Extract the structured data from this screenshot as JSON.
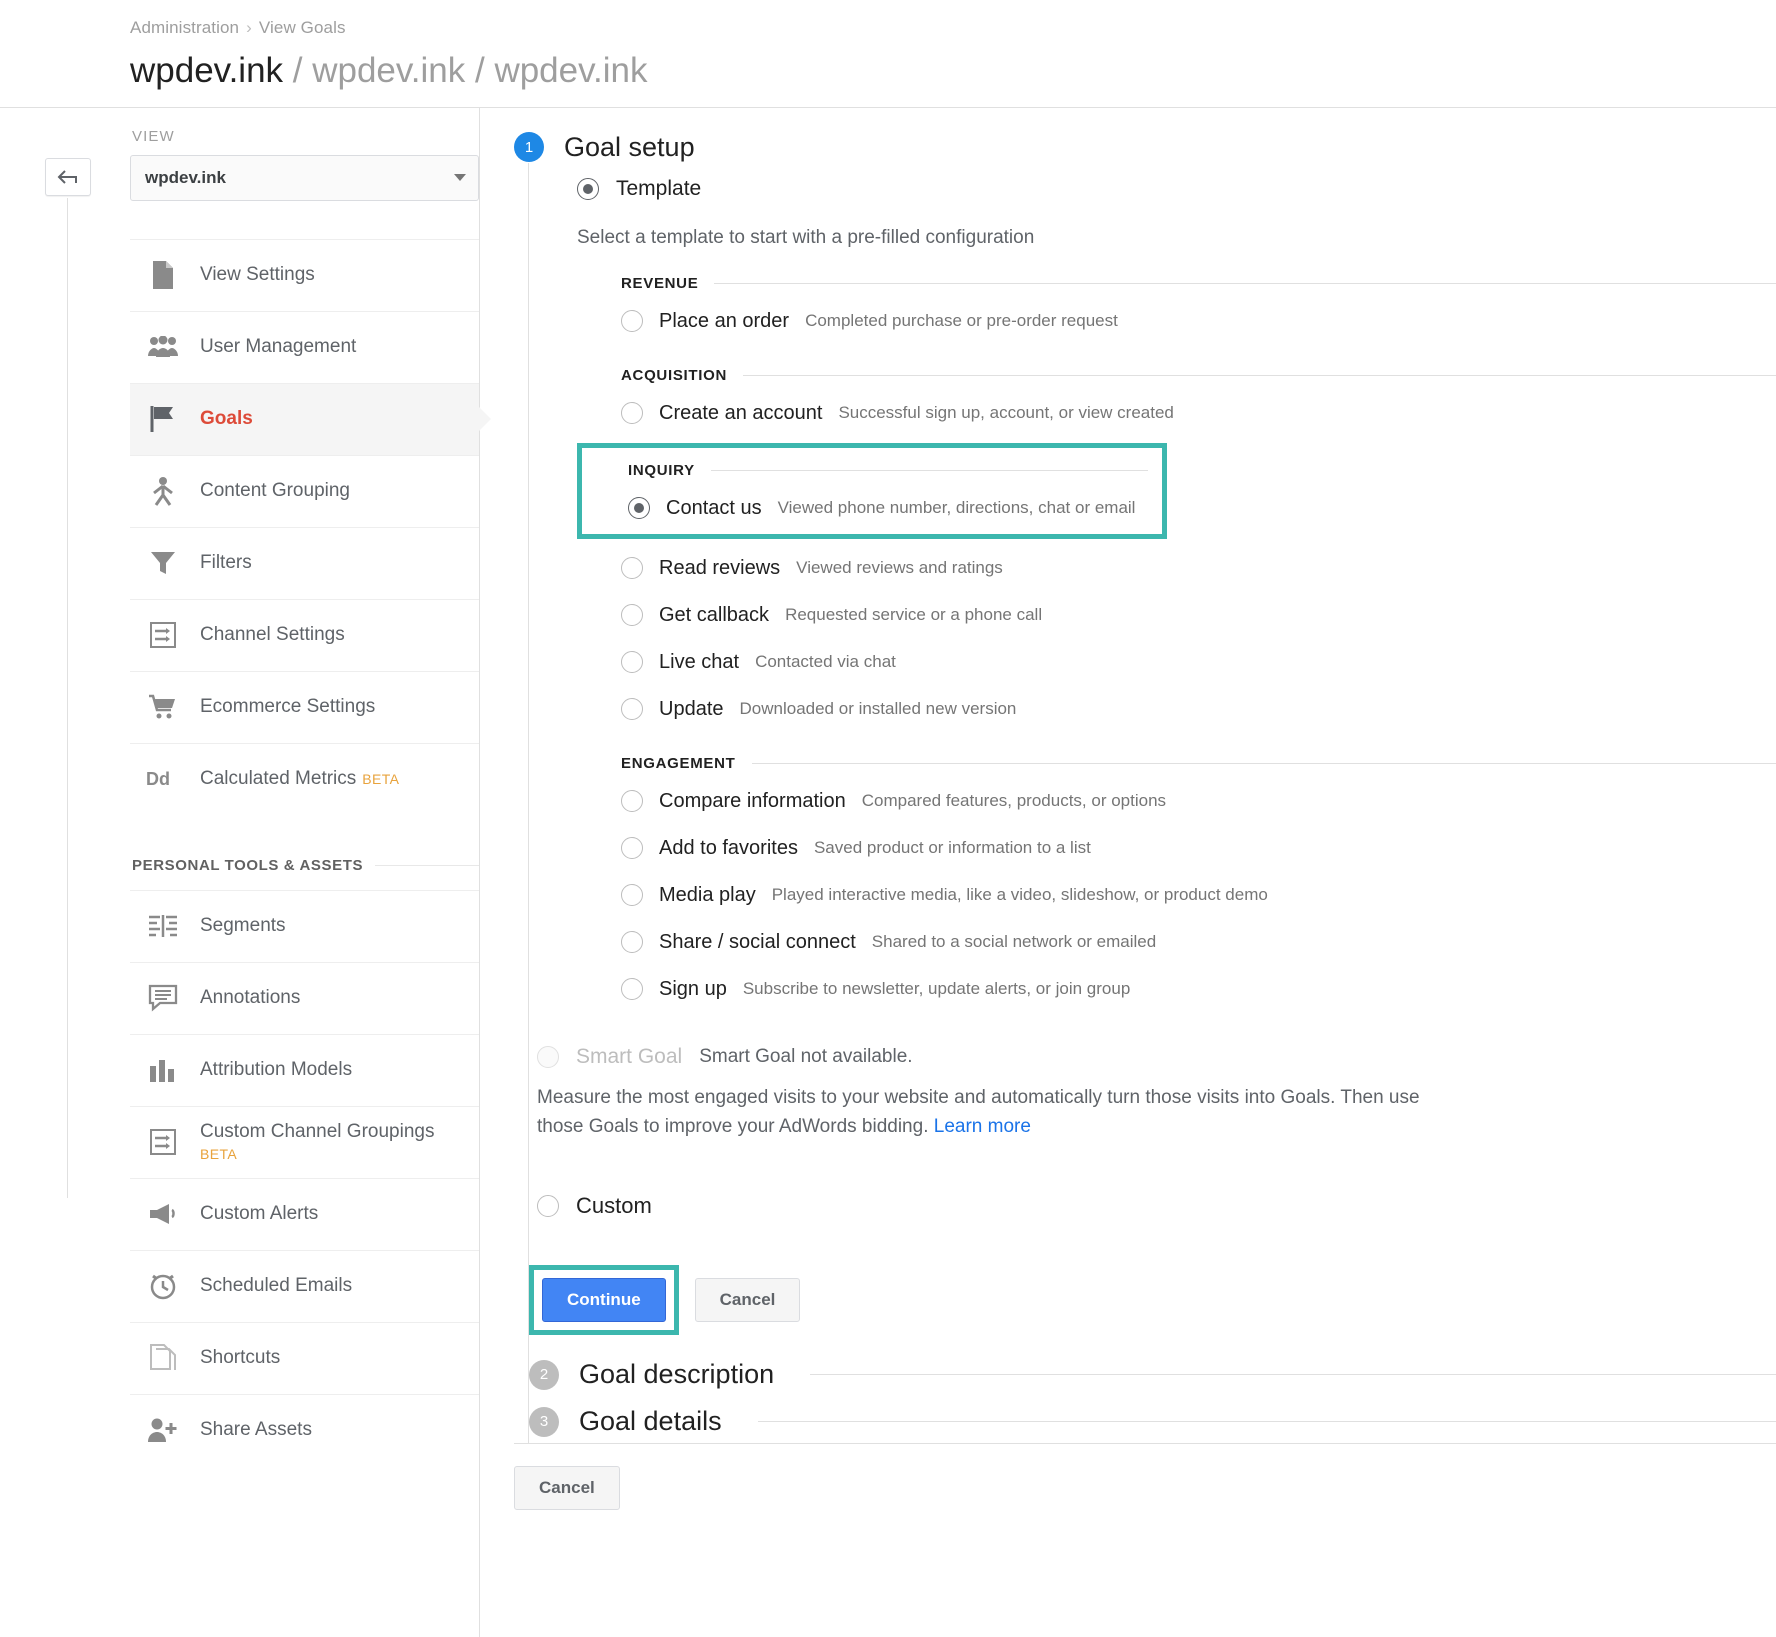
{
  "header": {
    "breadcrumb": [
      "Administration",
      "View Goals"
    ],
    "breadcrumb_separator": "›",
    "title_main": "wpdev.ink",
    "title_rest": "/ wpdev.ink / wpdev.ink"
  },
  "sidebar": {
    "view_label": "VIEW",
    "view_value": "wpdev.ink",
    "items": [
      {
        "label": "View Settings",
        "icon": "document-icon",
        "active": false
      },
      {
        "label": "User Management",
        "icon": "people-icon",
        "active": false
      },
      {
        "label": "Goals",
        "icon": "flag-icon",
        "active": true
      },
      {
        "label": "Content Grouping",
        "icon": "content-grouping-icon",
        "active": false
      },
      {
        "label": "Filters",
        "icon": "funnel-icon",
        "active": false
      },
      {
        "label": "Channel Settings",
        "icon": "channel-settings-icon",
        "active": false
      },
      {
        "label": "Ecommerce Settings",
        "icon": "cart-icon",
        "active": false
      },
      {
        "label": "Calculated Metrics",
        "icon": "dd-icon",
        "badge": "BETA",
        "active": false
      }
    ],
    "personal_section_label": "PERSONAL TOOLS & ASSETS",
    "personal_items": [
      {
        "label": "Segments",
        "icon": "segments-icon"
      },
      {
        "label": "Annotations",
        "icon": "annotation-icon"
      },
      {
        "label": "Attribution Models",
        "icon": "bar-chart-icon"
      },
      {
        "label": "Custom Channel Groupings",
        "icon": "channel-settings-icon",
        "badge": "BETA"
      },
      {
        "label": "Custom Alerts",
        "icon": "megaphone-icon"
      },
      {
        "label": "Scheduled Emails",
        "icon": "alarm-clock-icon"
      },
      {
        "label": "Shortcuts",
        "icon": "pages-icon"
      },
      {
        "label": "Share Assets",
        "icon": "person-add-icon"
      }
    ]
  },
  "main": {
    "step1": {
      "number": "1",
      "title": "Goal setup",
      "template_option_label": "Template",
      "template_selected": true,
      "template_description": "Select a template to start with a pre-filled configuration",
      "groups": [
        {
          "name": "REVENUE",
          "highlighted": false,
          "options": [
            {
              "name": "Place an order",
              "desc": "Completed purchase or pre-order request",
              "selected": false
            }
          ]
        },
        {
          "name": "ACQUISITION",
          "highlighted": false,
          "options": [
            {
              "name": "Create an account",
              "desc": "Successful sign up, account, or view created",
              "selected": false
            }
          ]
        },
        {
          "name": "INQUIRY",
          "highlighted": true,
          "options": [
            {
              "name": "Contact us",
              "desc": "Viewed phone number, directions, chat or email",
              "selected": true
            }
          ]
        },
        {
          "name": "",
          "highlighted": false,
          "options": [
            {
              "name": "Read reviews",
              "desc": "Viewed reviews and ratings",
              "selected": false
            },
            {
              "name": "Get callback",
              "desc": "Requested service or a phone call",
              "selected": false
            },
            {
              "name": "Live chat",
              "desc": "Contacted via chat",
              "selected": false
            },
            {
              "name": "Update",
              "desc": "Downloaded or installed new version",
              "selected": false
            }
          ]
        },
        {
          "name": "ENGAGEMENT",
          "highlighted": false,
          "options": [
            {
              "name": "Compare information",
              "desc": "Compared features, products, or options",
              "selected": false
            },
            {
              "name": "Add to favorites",
              "desc": "Saved product or information to a list",
              "selected": false
            },
            {
              "name": "Media play",
              "desc": "Played interactive media, like a video, slideshow, or product demo",
              "selected": false
            },
            {
              "name": "Share / social connect",
              "desc": "Shared to a social network or emailed",
              "selected": false
            },
            {
              "name": "Sign up",
              "desc": "Subscribe to newsletter, update alerts, or join group",
              "selected": false
            }
          ]
        }
      ],
      "smart_goal": {
        "label": "Smart Goal",
        "status": "Smart Goal not available.",
        "description": "Measure the most engaged visits to your website and automatically turn those visits into Goals. Then use those Goals to improve your AdWords bidding.",
        "link_text": "Learn more"
      },
      "custom_option_label": "Custom",
      "custom_selected": false,
      "continue_label": "Continue",
      "cancel_label": "Cancel",
      "continue_highlighted": true
    },
    "step2": {
      "number": "2",
      "title": "Goal description"
    },
    "step3": {
      "number": "3",
      "title": "Goal details"
    },
    "footer_cancel_label": "Cancel"
  },
  "colors": {
    "accent_blue": "#4285f4",
    "active_red": "#dd4b39",
    "highlight_teal": "#3cb7ae",
    "beta_orange": "#e8a33d",
    "link_blue": "#1a73e8"
  }
}
